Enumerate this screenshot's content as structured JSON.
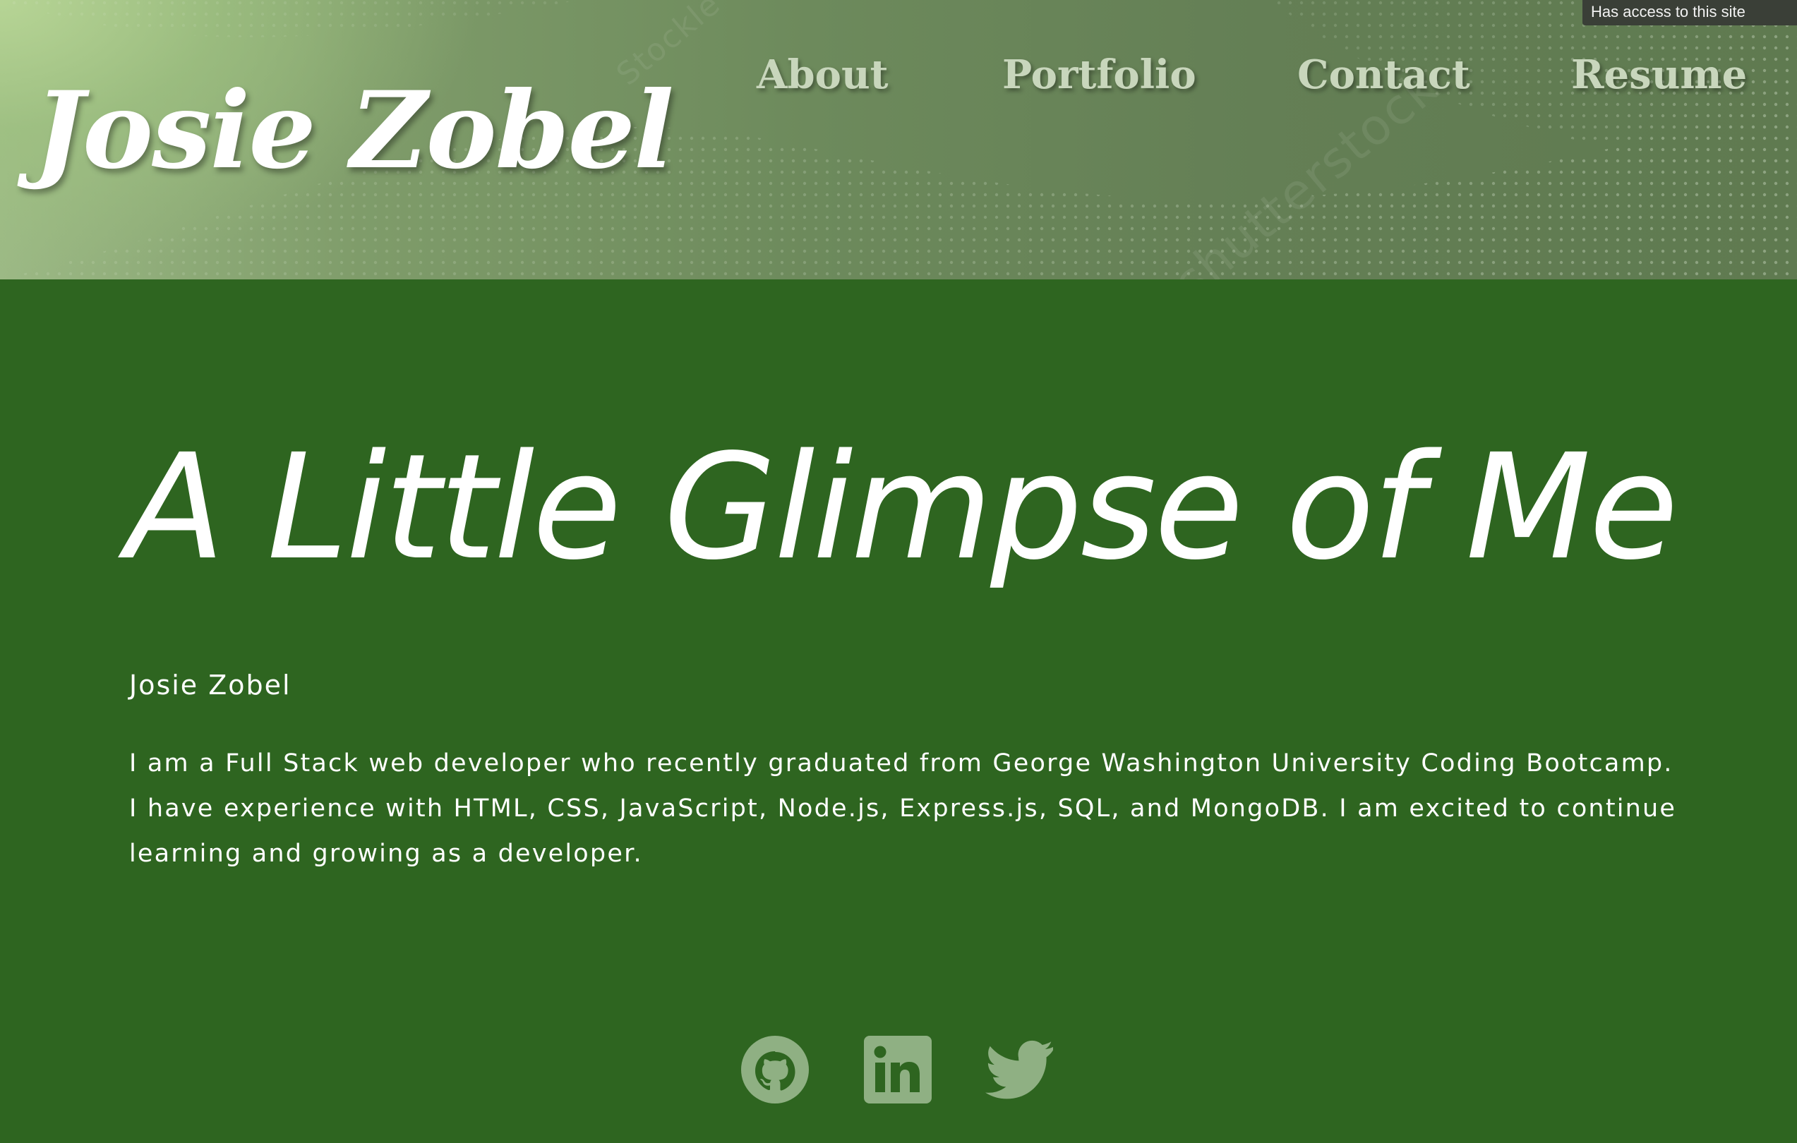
{
  "header": {
    "logo": "Josie Zobel",
    "nav": [
      {
        "label": "About"
      },
      {
        "label": "Portfolio"
      },
      {
        "label": "Contact"
      },
      {
        "label": "Resume"
      }
    ],
    "access_badge": "Has access to this site",
    "watermarks": [
      "shutterstock",
      "Stockle"
    ]
  },
  "main": {
    "title": "A Little Glimpse of Me",
    "name": "Josie Zobel",
    "bio": "I am a Full Stack web developer who recently graduated from George Washington University Coding Bootcamp. I have experience with HTML, CSS, JavaScript, Node.js, Express.js, SQL, and MongoDB. I am excited to continue learning and growing as a developer."
  },
  "social": [
    {
      "icon": "github-icon"
    },
    {
      "icon": "linkedin-icon"
    },
    {
      "icon": "twitter-icon"
    }
  ],
  "colors": {
    "background": "#2e6520",
    "nav_text": "#c8d6bc",
    "icon": "#8fb083",
    "header_light": "#b8d696",
    "header_dark": "#5f7a50"
  }
}
